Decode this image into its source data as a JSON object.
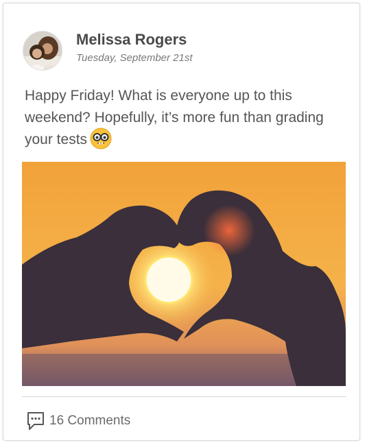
{
  "post": {
    "author": "Melissa Rogers",
    "date": "Tuesday, September 21st",
    "text": "Happy Friday!  What is everyone up to this weekend?  Hopefully, it’s more fun than grading your tests",
    "emoji": "nerd-face-emoji",
    "image": "hands forming a heart shape around a setting sun",
    "comments_label": "16 Comments"
  },
  "colors": {
    "text": "#555555",
    "sky_top": "#f2a23a",
    "sun": "#fffbe0",
    "silhouette": "#3a2f3a"
  }
}
